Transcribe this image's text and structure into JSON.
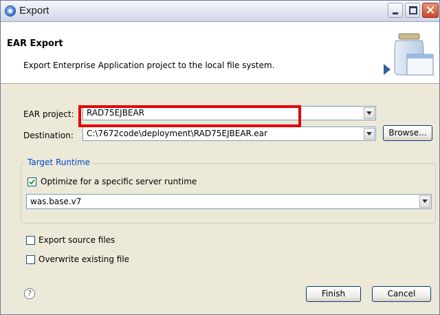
{
  "window": {
    "title": "Export"
  },
  "banner": {
    "title": "EAR Export",
    "description": "Export Enterprise Application project to the local file system."
  },
  "form": {
    "ear_project_label": "EAR project:",
    "ear_project_value": "RAD75EJBEAR",
    "destination_label": "Destination:",
    "destination_value": "C:\\7672code\\deployment\\RAD75EJBEAR.ear",
    "browse_label": "Browse..."
  },
  "target_runtime": {
    "legend": "Target Runtime",
    "optimize_label": "Optimize for a specific server runtime",
    "optimize_checked": true,
    "runtime_value": "was.base.v7"
  },
  "options": {
    "export_source_label": "Export source files",
    "export_source_checked": false,
    "overwrite_label": "Overwrite existing file",
    "overwrite_checked": false
  },
  "footer": {
    "help_symbol": "?",
    "finish_label": "Finish",
    "cancel_label": "Cancel"
  },
  "colors": {
    "highlight": "#e60000",
    "group_legend": "#0046d5",
    "dialog_bg": "#ece9d8"
  }
}
